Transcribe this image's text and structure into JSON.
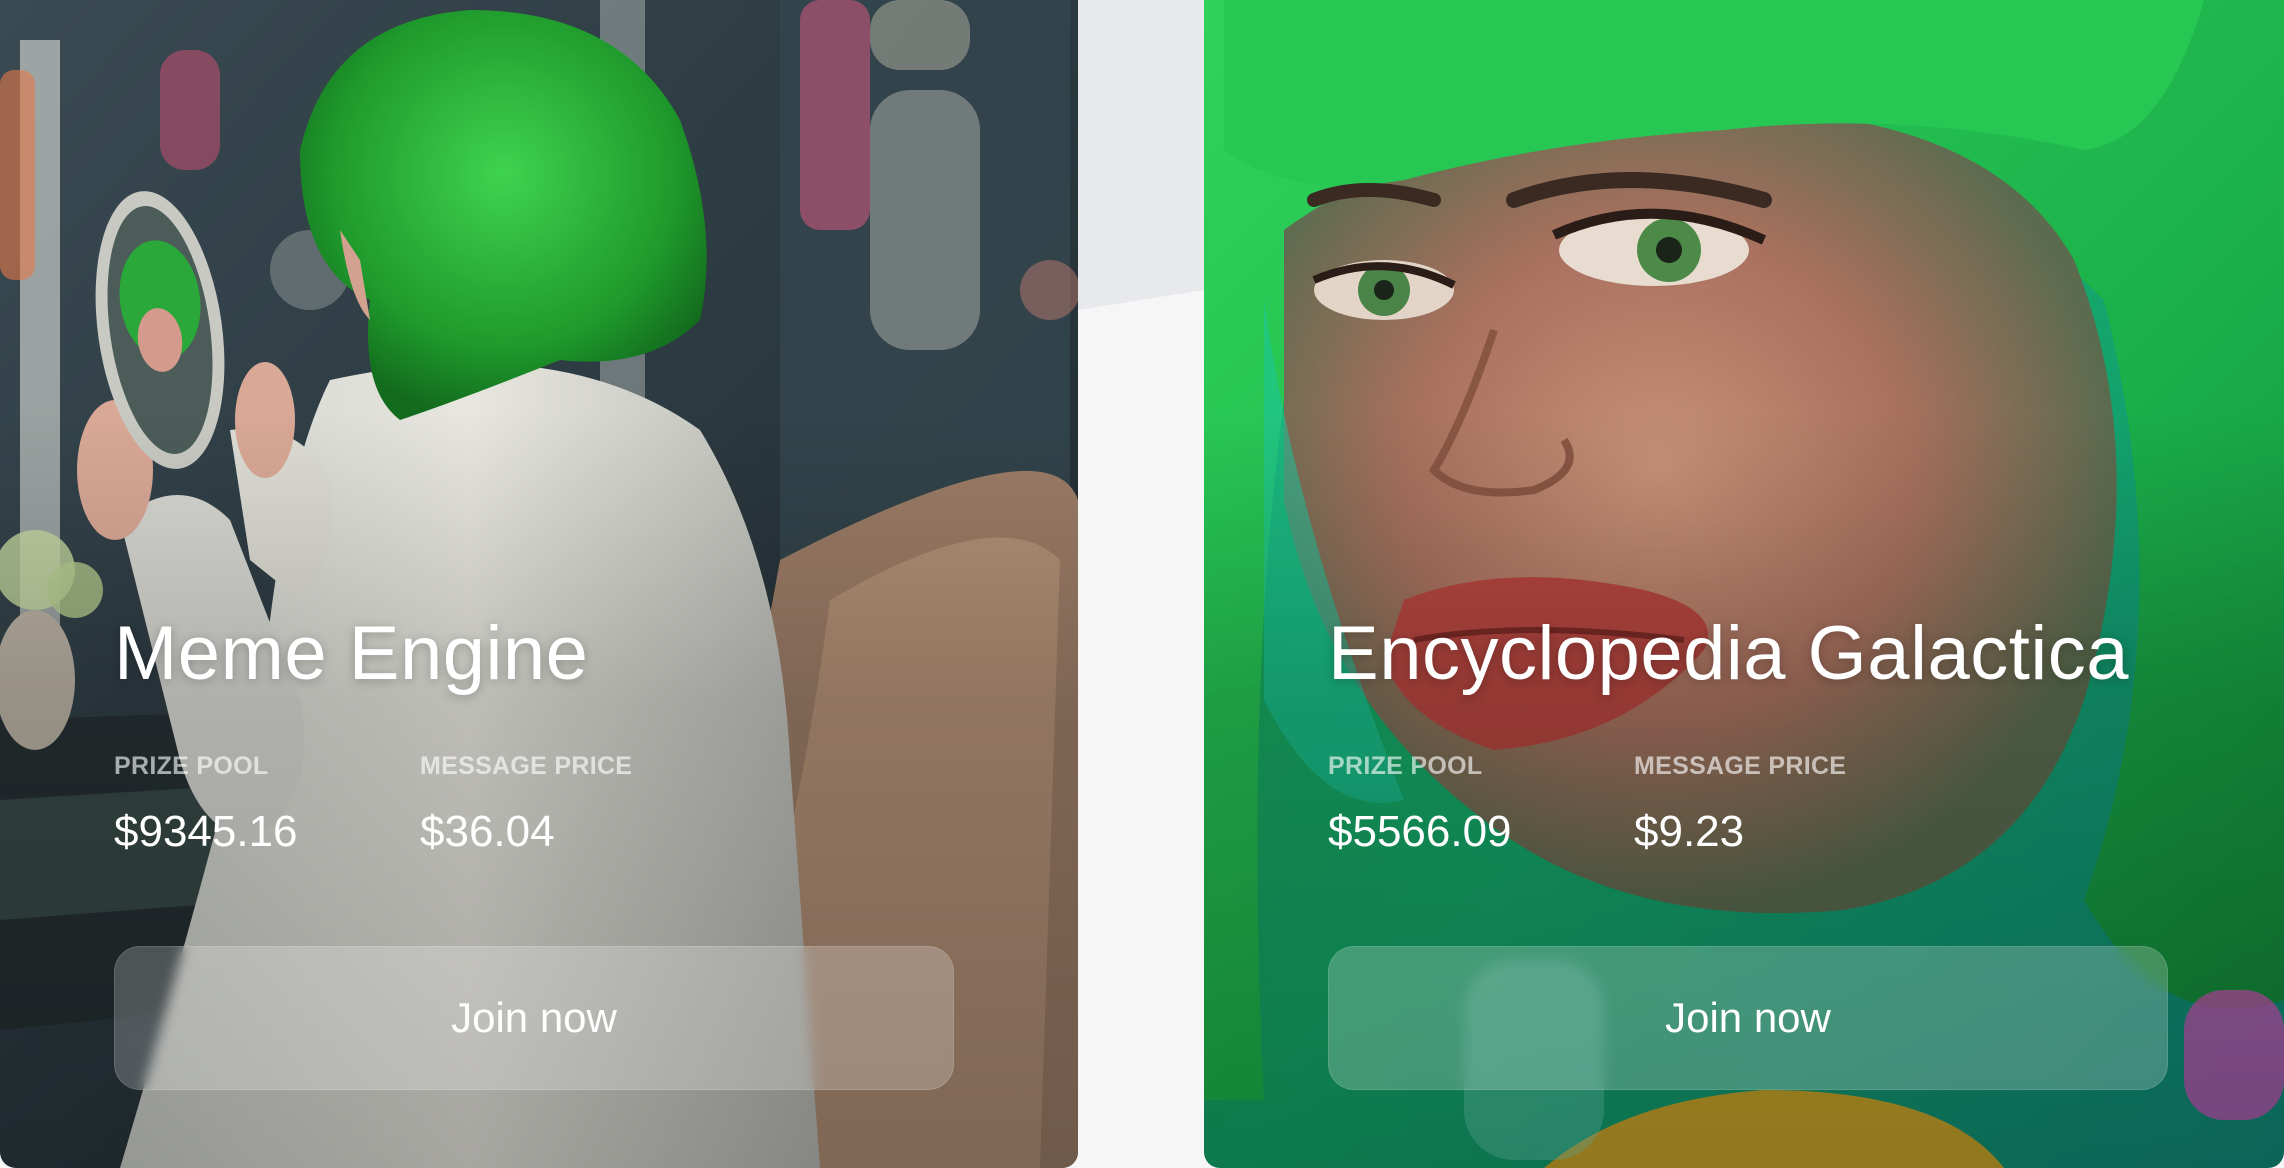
{
  "cards": [
    {
      "title": "Meme Engine",
      "prize_pool_label": "PRIZE POOL",
      "prize_pool_value": "$9345.16",
      "message_price_label": "MESSAGE PRICE",
      "message_price_value": "$36.04",
      "button_label": "Join now"
    },
    {
      "title": "Encyclopedia Galactica",
      "prize_pool_label": "PRIZE POOL",
      "prize_pool_value": "$5566.09",
      "message_price_label": "MESSAGE PRICE",
      "message_price_value": "$9.23",
      "button_label": "Join now"
    }
  ],
  "colors": {
    "page_background": "#f6f6f7",
    "backdrop_gray": "#e8e9ec",
    "accent_green": "#1fbf4a",
    "text": "#ffffff"
  }
}
